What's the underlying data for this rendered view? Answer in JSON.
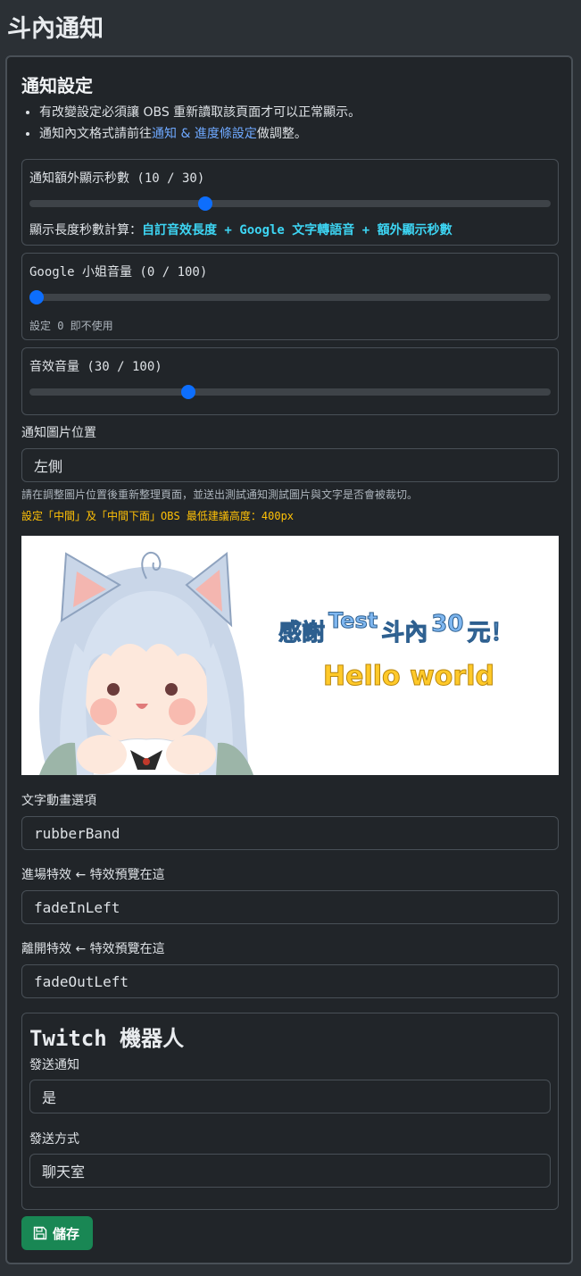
{
  "page": {
    "title": "斗內通知"
  },
  "settings": {
    "title": "通知設定",
    "notes": [
      {
        "text": "有改變設定必須讓 OBS 重新讀取該頁面才可以正常顯示。"
      },
      {
        "prefix": "通知內文格式請前往",
        "link": "通知 & 進度條設定",
        "suffix": "做調整。"
      }
    ]
  },
  "extra_seconds": {
    "label": "通知額外顯示秒數 (10 / 30)",
    "value": 10,
    "max": 30,
    "formula_prefix": "顯示長度秒數計算：",
    "formula": "自訂音效長度 + Google 文字轉語音 + 額外顯示秒數"
  },
  "google_volume": {
    "label": "Google 小姐音量 (0 / 100)",
    "value": 0,
    "max": 100,
    "hint": "設定 0 即不使用"
  },
  "sfx_volume": {
    "label": "音效音量 (30 / 100)",
    "value": 30,
    "max": 100
  },
  "image_position": {
    "label": "通知圖片位置",
    "value": "左側",
    "note": "請在調整圖片位置後重新整理頁面，並送出測試通知測試圖片與文字是否會被裁切。",
    "warning": "設定「中間」及「中間下面」OBS 最低建議高度：400px"
  },
  "preview": {
    "line1_a": "感謝",
    "line1_name": "Test",
    "line1_b": "斗內",
    "line1_amount": "30",
    "line1_c": "元！",
    "line2": "Hello world"
  },
  "text_animation": {
    "label": "文字動畫選項",
    "value": "rubberBand"
  },
  "enter_effect": {
    "label": "進場特效 ← 特效預覽在這",
    "value": "fadeInLeft"
  },
  "exit_effect": {
    "label": "離開特效 ← 特效預覽在這",
    "value": "fadeOutLeft"
  },
  "twitch_bot": {
    "title": "Twitch 機器人",
    "send_label": "發送通知",
    "send_value": "是",
    "method_label": "發送方式",
    "method_value": "聊天室"
  },
  "save_button": {
    "label": "儲存"
  },
  "colors": {
    "accent": "#0d6efd",
    "success": "#198754",
    "info": "#3dd5f3",
    "warning": "#ffc107",
    "link": "#6ea8fe"
  }
}
